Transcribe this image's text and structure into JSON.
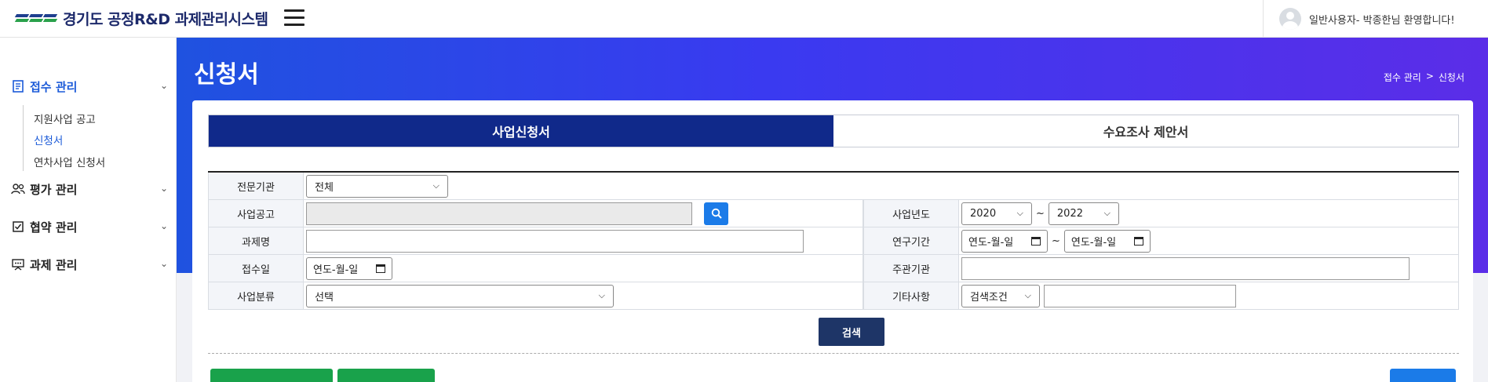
{
  "header": {
    "logo_text": "경기도 공정R&D 과제관리시스템",
    "welcome_text": "일반사용자- 박종한님 환영합니다!"
  },
  "sidebar": {
    "groups": [
      {
        "label": "접수 관리",
        "icon": "document-icon",
        "expanded": true
      },
      {
        "label": "평가 관리",
        "icon": "users-icon",
        "expanded": false
      },
      {
        "label": "협약 관리",
        "icon": "checkbox-icon",
        "expanded": false
      },
      {
        "label": "과제 관리",
        "icon": "presentation-icon",
        "expanded": false
      }
    ],
    "submenu": [
      "지원사업 공고",
      "신청서",
      "연차사업 신청서"
    ],
    "current_submenu": "신청서"
  },
  "page": {
    "title": "신청서",
    "breadcrumb": [
      "접수 관리",
      ">",
      "신청서"
    ]
  },
  "tabs": [
    {
      "label": "사업신청서",
      "active": true
    },
    {
      "label": "수요조사 제안서",
      "active": false
    }
  ],
  "search": {
    "labels": {
      "agency": "전문기관",
      "notice": "사업공고",
      "year": "사업년도",
      "project_name": "과제명",
      "period": "연구기간",
      "receipt_date": "접수일",
      "host": "주관기관",
      "category": "사업분류",
      "etc": "기타사항"
    },
    "agency_value": "전체",
    "year_from": "2020",
    "year_to": "2022",
    "tilde": "~",
    "date_placeholder": "연도-월-일",
    "category_value": "선택",
    "etc_condition": "검색조건",
    "search_button": "검색"
  },
  "colors": {
    "banner_start": "#1f52e0",
    "banner_end": "#5b2de8",
    "tab_active": "#10298a",
    "search_button": "#1e3567",
    "green_button": "#19a24b",
    "blue_button": "#1b7be8"
  }
}
